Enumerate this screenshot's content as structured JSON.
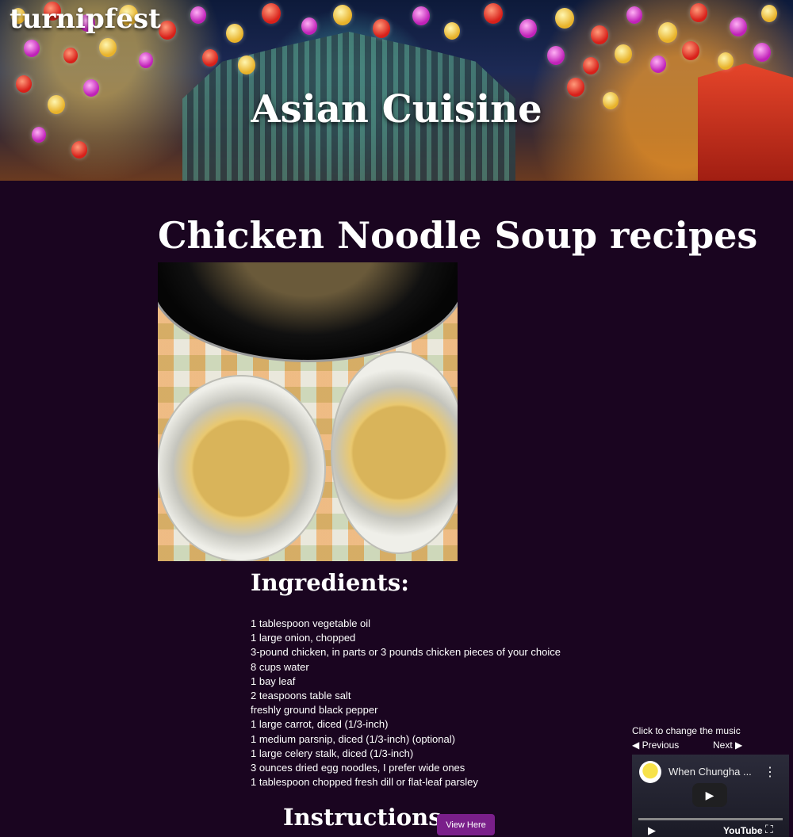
{
  "header": {
    "brand": "turnipfest",
    "title": "Asian Cuisine"
  },
  "main": {
    "title": "Chicken Noodle Soup recipes",
    "ingredients_heading": "Ingredients:",
    "ingredients": [
      "1 tablespoon vegetable oil",
      "1 large onion, chopped",
      "3-pound chicken, in parts or 3 pounds chicken pieces of your choice",
      "8 cups water",
      "1 bay leaf",
      "2 teaspoons table salt",
      "freshly ground black pepper",
      "1 large carrot, diced (1/3-inch)",
      "1 medium parsnip, diced (1/3-inch) (optional)",
      "1 large celery stalk, diced (1/3-inch)",
      "3 ounces dried egg noodles, I prefer wide ones",
      "1 tablespoon chopped fresh dill or flat-leaf parsley"
    ],
    "instructions_heading": "Instructions:",
    "view_button": "View Here"
  },
  "music": {
    "prompt": "Click to change the music",
    "previous": "◀ Previous",
    "next": "Next ▶",
    "video_title": "When Chungha ...",
    "platform": "YouTube"
  },
  "colors": {
    "page_background": "#1a0520",
    "button": "#7a1f8a"
  }
}
